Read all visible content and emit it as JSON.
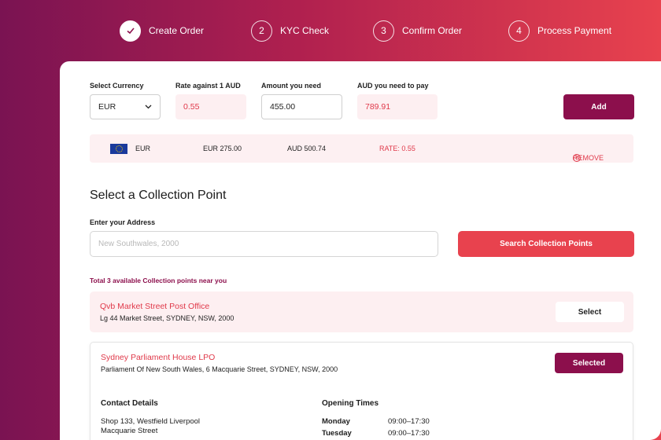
{
  "stepper": {
    "steps": [
      {
        "number": "✓",
        "label": "Create Order"
      },
      {
        "number": "2",
        "label": "KYC Check"
      },
      {
        "number": "3",
        "label": "Confirm Order"
      },
      {
        "number": "4",
        "label": "Process Payment"
      }
    ]
  },
  "order_form": {
    "currency_label": "Select Currency",
    "currency_value": "EUR",
    "rate_label": "Rate against 1 AUD",
    "rate_value": "0.55",
    "amount_label": "Amount you need",
    "amount_value": "455.00",
    "pay_label": "AUD you need to pay",
    "pay_value": "789.91",
    "add_label": "Add"
  },
  "summary": {
    "currency": "EUR",
    "foreign_amount": "EUR 275.00",
    "aud_amount": "AUD 500.74",
    "rate": "RATE: 0.55",
    "remove_label": "REMOVE"
  },
  "collection": {
    "title": "Select a Collection Point",
    "address_label": "Enter your Address",
    "address_placeholder": "New Southwales, 2000",
    "search_label": "Search Collection Points",
    "total_text": "Total 3 available Collection points near you",
    "points": [
      {
        "name": "Qvb Market Street Post Office",
        "address": "Lg 44 Market Street, SYDNEY, NSW, 2000",
        "button": "Select"
      },
      {
        "name": "Sydney Parliament House LPO",
        "address": "Parliament Of New South Wales, 6 Macquarie Street, SYDNEY, NSW, 2000",
        "button": "Selected",
        "contact_heading": "Contact Details",
        "contact_line1": "Shop 133, Westfield Liverpool",
        "contact_line2": "Macquarie Street",
        "hours_heading": "Opening Times",
        "hours": [
          {
            "day": "Monday",
            "time": "09:00–17:30"
          },
          {
            "day": "Tuesday",
            "time": "09:00–17:30"
          }
        ]
      }
    ]
  },
  "colors": {
    "primary": "#8c0f4c",
    "accent": "#e8424e",
    "pink_bg": "#fdeff1"
  }
}
